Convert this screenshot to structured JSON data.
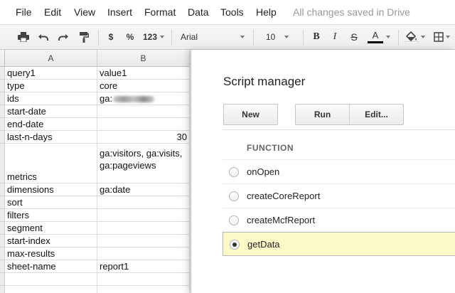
{
  "menu": {
    "items": [
      "File",
      "Edit",
      "View",
      "Insert",
      "Format",
      "Data",
      "Tools",
      "Help"
    ],
    "save_status": "All changes saved in Drive"
  },
  "toolbar": {
    "currency_label": "$",
    "percent_label": "%",
    "number_format_label": "123",
    "font_name": "Arial",
    "font_size": "10",
    "bold_label": "B",
    "italic_label": "I",
    "strike_label": "S",
    "text_color_label": "A",
    "text_color": "#000000",
    "icons": [
      "print-icon",
      "undo-icon",
      "redo-icon",
      "paint-format-icon",
      "fill-color-icon",
      "borders-icon"
    ]
  },
  "sheet": {
    "columns": [
      "A",
      "B"
    ],
    "rows": [
      {
        "a": "query1",
        "b": "value1"
      },
      {
        "a": "type",
        "b": "core"
      },
      {
        "a": "ids",
        "b": "ga:",
        "b_redacted": true
      },
      {
        "a": "start-date",
        "b": ""
      },
      {
        "a": "end-date",
        "b": ""
      },
      {
        "a": "last-n-days",
        "b": "30"
      },
      {
        "a": "metrics",
        "b": "ga:visitors, ga:visits, ga:pageviews"
      },
      {
        "a": "dimensions",
        "b": "ga:date"
      },
      {
        "a": "sort",
        "b": ""
      },
      {
        "a": "filters",
        "b": ""
      },
      {
        "a": "segment",
        "b": ""
      },
      {
        "a": "start-index",
        "b": ""
      },
      {
        "a": "max-results",
        "b": ""
      },
      {
        "a": "sheet-name",
        "b": "report1"
      }
    ]
  },
  "dialog": {
    "title": "Script manager",
    "buttons": {
      "new": "New",
      "run": "Run",
      "edit": "Edit..."
    },
    "function_header": "FUNCTION",
    "functions": [
      {
        "name": "onOpen",
        "selected": false
      },
      {
        "name": "createCoreReport",
        "selected": false
      },
      {
        "name": "createMcfReport",
        "selected": false
      },
      {
        "name": "getData",
        "selected": true
      }
    ],
    "selected_row_color": "#fcfac9"
  }
}
